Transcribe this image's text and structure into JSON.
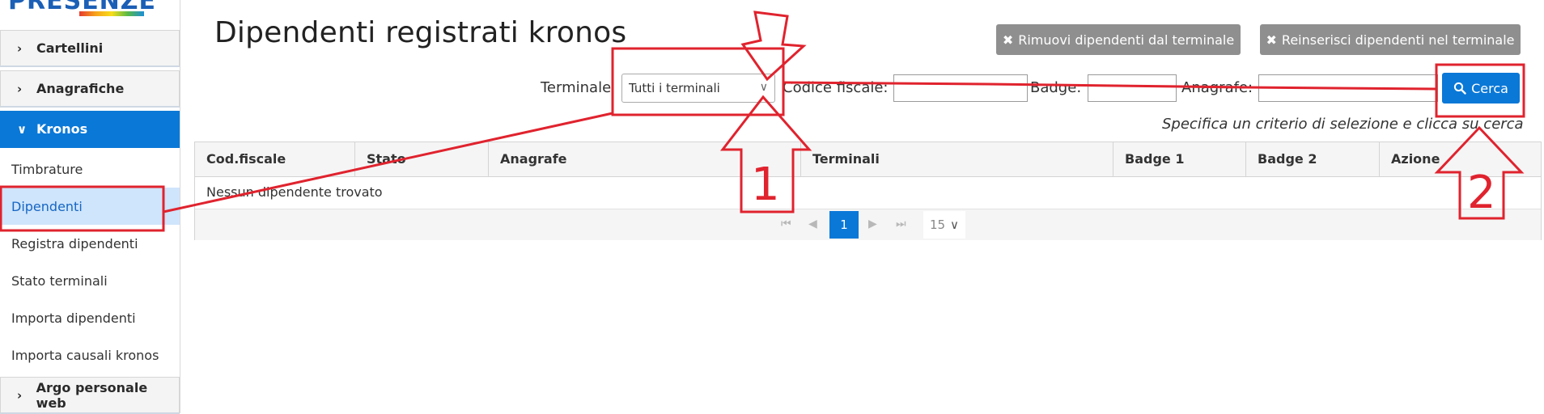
{
  "sidebar": {
    "logo": "PRESENZE",
    "groups": [
      {
        "label": "Cartellini",
        "icon": "chevron-right-icon"
      },
      {
        "label": "Anagrafiche",
        "icon": "chevron-right-icon"
      },
      {
        "label": "Kronos",
        "icon": "chevron-down-icon"
      },
      {
        "label": "Argo personale web",
        "icon": "chevron-right-icon"
      }
    ],
    "items": [
      {
        "label": "Timbrature"
      },
      {
        "label": "Dipendenti"
      },
      {
        "label": "Registra dipendenti"
      },
      {
        "label": "Stato terminali"
      },
      {
        "label": "Importa dipendenti"
      },
      {
        "label": "Importa causali kronos"
      }
    ]
  },
  "page": {
    "title": "Dipendenti registrati kronos",
    "remove_button": "Rimuovi dipendenti dal terminale",
    "reinsert_button": "Reinserisci dipendenti nel terminale"
  },
  "filters": {
    "terminale_label": "Terminale",
    "terminale_value": "Tutti i terminali",
    "codice_fiscale_label": "Codice fiscale:",
    "badge_label": "Badge:",
    "anagrafe_label": "Anagrafe:",
    "search_button": "Cerca",
    "hint": "Specifica un criterio di selezione e clicca su cerca"
  },
  "table": {
    "columns": [
      "Cod.fiscale",
      "Stato",
      "Anagrafe",
      "Terminali",
      "Badge 1",
      "Badge 2",
      "Azione"
    ],
    "empty_message": "Nessun dipendente trovato",
    "pager": {
      "current_page": "1",
      "page_size": "15"
    }
  },
  "annotations": {
    "marker_1": "1",
    "marker_2": "2",
    "color": "#e0232e"
  }
}
